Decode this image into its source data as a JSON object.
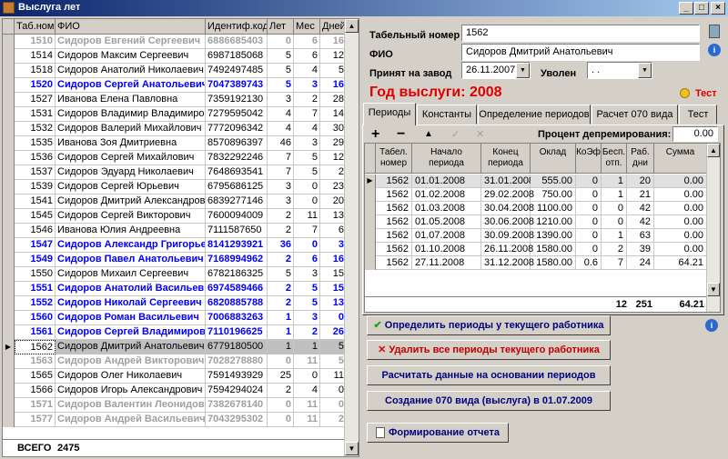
{
  "window": {
    "title": "Выслуга лет"
  },
  "grid": {
    "headers": {
      "tab": "Таб.номер",
      "fio": "ФИО",
      "ident": "Идентиф.код",
      "let": "Лет",
      "mes": "Мес",
      "dney": "Дней"
    },
    "rows": [
      {
        "tab": "1510",
        "fio": "Сидоров Евгений Сергеевич",
        "ident": "6886685403",
        "let": "0",
        "mes": "6",
        "dney": "16",
        "style": "gray"
      },
      {
        "tab": "1514",
        "fio": "Сидоров Максим Сергеевич",
        "ident": "6987185068",
        "let": "5",
        "mes": "6",
        "dney": "12",
        "style": "normal"
      },
      {
        "tab": "1518",
        "fio": "Сидоров Анатолий Николаевич",
        "ident": "7492497485",
        "let": "5",
        "mes": "4",
        "dney": "5",
        "style": "normal"
      },
      {
        "tab": "1520",
        "fio": "Сидоров Сергей Анатольевич",
        "ident": "7047389743",
        "let": "5",
        "mes": "3",
        "dney": "16",
        "style": "blue"
      },
      {
        "tab": "1527",
        "fio": "Иванова Елена Павловна",
        "ident": "7359192130",
        "let": "3",
        "mes": "2",
        "dney": "28",
        "style": "normal"
      },
      {
        "tab": "1531",
        "fio": "Сидоров Владимир Владимирович",
        "ident": "7279595042",
        "let": "4",
        "mes": "7",
        "dney": "14",
        "style": "normal"
      },
      {
        "tab": "1532",
        "fio": "Сидоров Валерий Михайлович",
        "ident": "7772096342",
        "let": "4",
        "mes": "4",
        "dney": "30",
        "style": "normal"
      },
      {
        "tab": "1535",
        "fio": "Иванова Зоя Дмитриевна",
        "ident": "8570896397",
        "let": "46",
        "mes": "3",
        "dney": "29",
        "style": "normal"
      },
      {
        "tab": "1536",
        "fio": "Сидоров Сергей Михайлович",
        "ident": "7832292246",
        "let": "7",
        "mes": "5",
        "dney": "12",
        "style": "normal"
      },
      {
        "tab": "1537",
        "fio": "Сидоров Эдуард Николаевич",
        "ident": "7648693541",
        "let": "7",
        "mes": "5",
        "dney": "2",
        "style": "normal"
      },
      {
        "tab": "1539",
        "fio": "Сидоров Сергей Юрьевич",
        "ident": "6795686125",
        "let": "3",
        "mes": "0",
        "dney": "23",
        "style": "normal"
      },
      {
        "tab": "1541",
        "fio": "Сидоров Дмитрий Александрович",
        "ident": "6839277146",
        "let": "3",
        "mes": "0",
        "dney": "20",
        "style": "normal"
      },
      {
        "tab": "1545",
        "fio": "Сидоров Сергей Викторович",
        "ident": "7600094009",
        "let": "2",
        "mes": "11",
        "dney": "13",
        "style": "normal"
      },
      {
        "tab": "1546",
        "fio": "Иванова Юлия Андреевна",
        "ident": "7111587650",
        "let": "2",
        "mes": "7",
        "dney": "6",
        "style": "normal"
      },
      {
        "tab": "1547",
        "fio": "Сидоров Александр Григорьевич",
        "ident": "8141293921",
        "let": "36",
        "mes": "0",
        "dney": "3",
        "style": "blue"
      },
      {
        "tab": "1549",
        "fio": "Сидоров Павел Анатольевич",
        "ident": "7168994962",
        "let": "2",
        "mes": "6",
        "dney": "16",
        "style": "blue"
      },
      {
        "tab": "1550",
        "fio": "Сидоров Михаил Сергеевич",
        "ident": "6782186325",
        "let": "5",
        "mes": "3",
        "dney": "15",
        "style": "normal"
      },
      {
        "tab": "1551",
        "fio": "Сидоров Анатолий Васильевич",
        "ident": "6974589466",
        "let": "2",
        "mes": "5",
        "dney": "15",
        "style": "blue"
      },
      {
        "tab": "1552",
        "fio": "Сидоров Николай Сергеевич",
        "ident": "6820885788",
        "let": "2",
        "mes": "5",
        "dney": "13",
        "style": "blue"
      },
      {
        "tab": "1560",
        "fio": "Сидоров Роман Васильевич",
        "ident": "7006883263",
        "let": "1",
        "mes": "3",
        "dney": "0",
        "style": "blue"
      },
      {
        "tab": "1561",
        "fio": "Сидоров Сергей Владимирович",
        "ident": "7110196625",
        "let": "1",
        "mes": "2",
        "dney": "26",
        "style": "blue"
      },
      {
        "tab": "1562",
        "fio": "Сидоров Дмитрий Анатольевич",
        "ident": "6779180500",
        "let": "1",
        "mes": "1",
        "dney": "5",
        "style": "selected"
      },
      {
        "tab": "1563",
        "fio": "Сидоров Андрей Викторович",
        "ident": "7028278880",
        "let": "0",
        "mes": "11",
        "dney": "5",
        "style": "gray"
      },
      {
        "tab": "1565",
        "fio": "Сидоров Олег Николаевич",
        "ident": "7591493929",
        "let": "25",
        "mes": "0",
        "dney": "11",
        "style": "normal"
      },
      {
        "tab": "1566",
        "fio": "Сидоров Игорь Александрович",
        "ident": "7594294024",
        "let": "2",
        "mes": "4",
        "dney": "0",
        "style": "normal"
      },
      {
        "tab": "1571",
        "fio": "Сидоров Валентин Леонидович",
        "ident": "7382678140",
        "let": "0",
        "mes": "11",
        "dney": "0",
        "style": "gray"
      },
      {
        "tab": "1577",
        "fio": "Сидоров Андрей Васильевич",
        "ident": "7043295302",
        "let": "0",
        "mes": "11",
        "dney": "2",
        "style": "gray"
      }
    ],
    "footer": {
      "label": "ВСЕГО",
      "count": "2475"
    }
  },
  "form": {
    "tab_label": "Табельный номер",
    "tab_value": "1562",
    "fio_label": "ФИО",
    "fio_value": "Сидоров Дмитрий Анатольевич",
    "hired_label": "Принят на завод",
    "hired_value": "26.11.2007",
    "fired_label": "Уволен",
    "fired_value": ". .",
    "year_title": "Год выслуги: 2008",
    "test_label": "Тест"
  },
  "tabs": [
    "Периоды",
    "Константы",
    "Определение периодов",
    "Расчет 070 вида",
    "Тест"
  ],
  "toolbar": {
    "percent_label": "Процент депремирования:",
    "percent_value": "0.00"
  },
  "periods": {
    "headers": {
      "tab": "Табел. номер",
      "start": "Начало периода",
      "end": "Конец периода",
      "oklad": "Оклад",
      "koef": "КоЭф",
      "besp": "Бесп. отп.",
      "rab": "Раб. дни",
      "sum": "Сумма"
    },
    "rows": [
      {
        "tab": "1562",
        "start": "01.01.2008",
        "end": "31.01.2008",
        "oklad": "555.00",
        "koef": "0",
        "besp": "1",
        "rab": "20",
        "sum": "0.00"
      },
      {
        "tab": "1562",
        "start": "01.02.2008",
        "end": "29.02.2008",
        "oklad": "750.00",
        "koef": "0",
        "besp": "1",
        "rab": "21",
        "sum": "0.00"
      },
      {
        "tab": "1562",
        "start": "01.03.2008",
        "end": "30.04.2008",
        "oklad": "1100.00",
        "koef": "0",
        "besp": "0",
        "rab": "42",
        "sum": "0.00"
      },
      {
        "tab": "1562",
        "start": "01.05.2008",
        "end": "30.06.2008",
        "oklad": "1210.00",
        "koef": "0",
        "besp": "0",
        "rab": "42",
        "sum": "0.00"
      },
      {
        "tab": "1562",
        "start": "01.07.2008",
        "end": "30.09.2008",
        "oklad": "1390.00",
        "koef": "0",
        "besp": "1",
        "rab": "63",
        "sum": "0.00"
      },
      {
        "tab": "1562",
        "start": "01.10.2008",
        "end": "26.11.2008",
        "oklad": "1580.00",
        "koef": "0",
        "besp": "2",
        "rab": "39",
        "sum": "0.00"
      },
      {
        "tab": "1562",
        "start": "27.11.2008",
        "end": "31.12.2008",
        "oklad": "1580.00",
        "koef": "0.6",
        "besp": "7",
        "rab": "24",
        "sum": "64.21"
      }
    ],
    "totals": {
      "besp": "12",
      "rab": "251",
      "sum": "64.21"
    }
  },
  "buttons": {
    "define": "Определить периоды у текущего работника",
    "delete": "Удалить все периоды текущего работника",
    "calc": "Расчитать данные на основании периодов",
    "create070": "Создание 070 вида (выслуга) в 01.07.2009",
    "report": "Формирование отчета"
  },
  "colors": {
    "blue": "#0000ff",
    "gray": "#a0a0a0",
    "red": "#e00000",
    "selected": "#c0c0c0"
  }
}
